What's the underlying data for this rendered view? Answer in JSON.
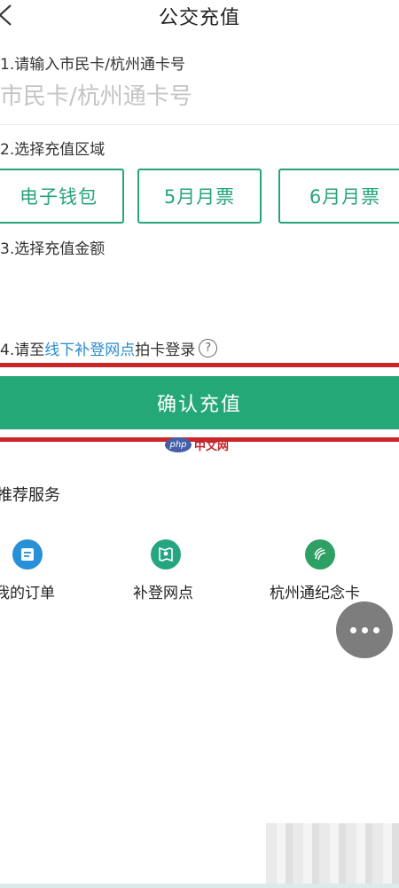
{
  "header": {
    "title": "公交充值"
  },
  "steps": {
    "step1_label": "1.请输入市民卡/杭州通卡号",
    "card_input_placeholder": "市民卡/杭州通卡号",
    "step2_label": "2.选择充值区域",
    "step3_label": "3.选择充值金额",
    "step4_prefix": "4.请至",
    "step4_link": "线下补登网点",
    "step4_suffix": "拍卡登录",
    "help_glyph": "?"
  },
  "recharge_options": [
    {
      "label": "电子钱包"
    },
    {
      "label": "5月月票"
    },
    {
      "label": "6月月票"
    }
  ],
  "confirm_button": {
    "label": "确认充值"
  },
  "watermark": {
    "logo_text": "php",
    "text": "中文网"
  },
  "recommended": {
    "title": "推荐服务",
    "items": [
      {
        "label": "我的订单",
        "icon": "order-list-icon"
      },
      {
        "label": "补登网点",
        "icon": "map-pin-icon"
      },
      {
        "label": "杭州通纪念卡",
        "icon": "card-icon"
      }
    ]
  },
  "colors": {
    "accent_green": "#25a878",
    "link_blue": "#2a8bd0",
    "highlight_red": "#c8262b",
    "more_button_gray": "#7d7d7d"
  }
}
